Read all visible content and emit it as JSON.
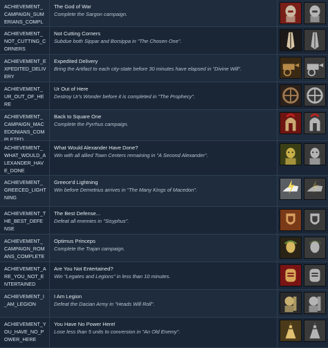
{
  "achievements": [
    {
      "id": "ACHIEVEMENT_CAMPAIGN_SUMERIANS_COMPLETED",
      "title": "The God of War",
      "description": "Complete the Sargon campaign.",
      "icon": "warrior-helmet-icon",
      "bg": "#7a1e18",
      "fg": "#c9b9a2"
    },
    {
      "id": "ACHIEVEMENT_NOT_CUTTING_CORNERS",
      "title": "Not Cutting Corners",
      "description": "Subdue both Sippar and Borsippa in \"The Chosen One\".",
      "icon": "praying-hands-icon",
      "bg": "#1c1a18",
      "fg": "#d8c6a6"
    },
    {
      "id": "ACHIEVEMENT_EXPEDITED_DELIVERY",
      "title": "Expedited Delivery",
      "description": "Bring the Artifact to each city-state before 30 minutes have elapsed in \"Divine Will\".",
      "icon": "chariot-icon",
      "bg": "#3a2a14",
      "fg": "#b88a4a"
    },
    {
      "id": "ACHIEVEMENT_UR_OUT_OF_HERE",
      "title": "Ur Out of Here",
      "description": "Destroy Ur's Wonder before it is completed in \"The Prophecy\".",
      "icon": "wheel-icon",
      "bg": "#2b211a",
      "fg": "#a07a52"
    },
    {
      "id": "ACHIEVEMENT_CAMPAIGN_MACEDONIANS_COMPLETED",
      "title": "Back to Square One",
      "description": "Complete the Pyrrhus campaign.",
      "icon": "hoplite-helmet-icon",
      "bg": "#6e1512",
      "fg": "#caa872"
    },
    {
      "id": "ACHIEVEMENT_WHAT_WOULD_ALEXANDER_HAVE_DONE",
      "title": "What Would Alexander Have Done?",
      "description": "Win with all allied Town Centers remaining in \"A Second Alexander\".",
      "icon": "alexander-portrait-icon",
      "bg": "#3a3f16",
      "fg": "#c9b04a"
    },
    {
      "id": "ACHIEVEMENT_GREECED_LIGHTNING",
      "title": "Greece'd Lightning",
      "description": "Win before Demetrius arrives in \"The Many Kings of Macedon\".",
      "icon": "lightning-chariot-icon",
      "bg": "#5a5d62",
      "fg": "#f0f0f0"
    },
    {
      "id": "ACHIEVEMENT_THE_BEST_DEFENSE",
      "title": "The Best Defense...",
      "description": "Defeat all enemies in \"Sisyphus\".",
      "icon": "shield-wall-icon",
      "bg": "#7a3a18",
      "fg": "#d8a060"
    },
    {
      "id": "ACHIEVEMENT_CAMPAIGN_ROMANS_COMPLETED",
      "title": "Optimus Princeps",
      "description": "Complete the Trajan campaign.",
      "icon": "laurel-bust-icon",
      "bg": "#2a2416",
      "fg": "#d8b860"
    },
    {
      "id": "ACHIEVEMENT_ARE_YOU_NOT_ENTERTAINED",
      "title": "Are You Not Entertained?",
      "description": "Win \"Legates and Legions\" in less than 10 minutes.",
      "icon": "gladiator-icon",
      "bg": "#7a1414",
      "fg": "#d8a858"
    },
    {
      "id": "ACHIEVEMENT_I_AM_LEGION",
      "title": "I Am Legion",
      "description": "Defeat the Dacian Army in \"Heads Will Roll\".",
      "icon": "legionary-icon",
      "bg": "#2a2a2c",
      "fg": "#c8b070"
    },
    {
      "id": "ACHIEVEMENT_YOU_HAVE_NO_POWER_HERE",
      "title": "You Have No Power Here!",
      "description": "Lose less than 5 units to conversion in \"An Old Enemy\".",
      "icon": "priest-icon",
      "bg": "#4a3a1a",
      "fg": "#e0c070"
    }
  ]
}
